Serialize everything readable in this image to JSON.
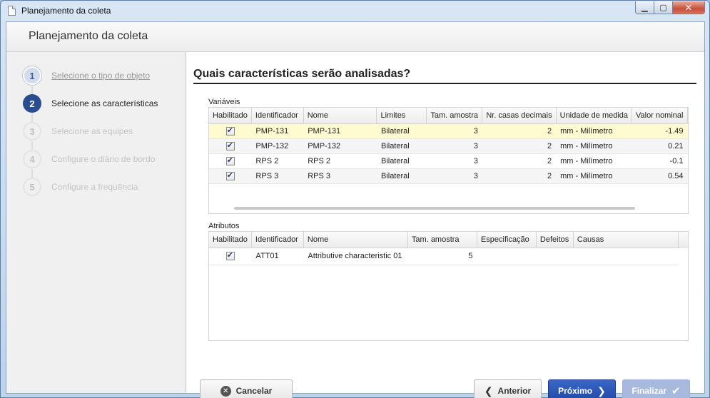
{
  "window": {
    "title": "Planejamento da coleta",
    "controls": {
      "minimize": "▁",
      "maximize": "▢",
      "close": "✕"
    }
  },
  "header": {
    "title": "Planejamento da coleta"
  },
  "steps": [
    {
      "num": "1",
      "label": "Selecione o tipo de objeto",
      "state": "done"
    },
    {
      "num": "2",
      "label": "Selecione as características",
      "state": "current"
    },
    {
      "num": "3",
      "label": "Selecione as equipes",
      "state": "todo"
    },
    {
      "num": "4",
      "label": "Configure o diário de bordo",
      "state": "todo"
    },
    {
      "num": "5",
      "label": "Configure a frequência",
      "state": "todo"
    }
  ],
  "main": {
    "question": "Quais características serão analisadas?",
    "variables": {
      "label": "Variáveis",
      "columns": [
        "Habilitado",
        "Identificador",
        "Nome",
        "Limites",
        "Tam. amostra",
        "Nr. casas decimais",
        "Unidade de medida",
        "Valor nominal"
      ],
      "rows": [
        {
          "enabled": true,
          "id": "PMP-131",
          "name": "PMP-131",
          "limits": "Bilateral",
          "sample": "3",
          "decimals": "2",
          "unit": "mm - Milímetro",
          "nominal": "-1.49"
        },
        {
          "enabled": true,
          "id": "PMP-132",
          "name": "PMP-132",
          "limits": "Bilateral",
          "sample": "3",
          "decimals": "2",
          "unit": "mm - Milímetro",
          "nominal": "0.21"
        },
        {
          "enabled": true,
          "id": "RPS 2",
          "name": "RPS 2",
          "limits": "Bilateral",
          "sample": "3",
          "decimals": "2",
          "unit": "mm - Milímetro",
          "nominal": "-0.1"
        },
        {
          "enabled": true,
          "id": "RPS 3",
          "name": "RPS 3",
          "limits": "Bilateral",
          "sample": "3",
          "decimals": "2",
          "unit": "mm - Milímetro",
          "nominal": "0.54"
        }
      ]
    },
    "attributes": {
      "label": "Atributos",
      "columns": [
        "Habilitado",
        "Identificador",
        "Nome",
        "Tam. amostra",
        "Especificação",
        "Defeitos",
        "Causas"
      ],
      "rows": [
        {
          "enabled": true,
          "id": "ATT01",
          "name": "Attributive characteristic 01",
          "sample": "5",
          "spec": "",
          "defects": "",
          "causes": ""
        }
      ]
    }
  },
  "buttons": {
    "cancel": "Cancelar",
    "previous": "Anterior",
    "next": "Próximo",
    "finish": "Finalizar"
  }
}
